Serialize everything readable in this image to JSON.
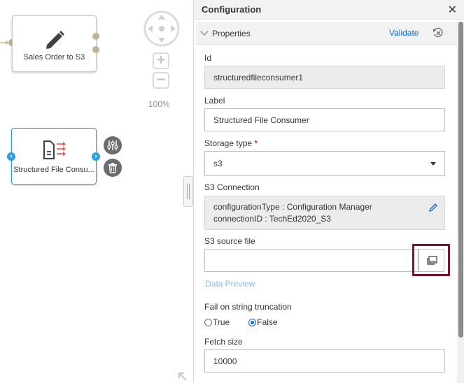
{
  "canvas": {
    "nodes": [
      {
        "label": "Sales Order to S3",
        "icon": "pencil-icon"
      },
      {
        "label": "Structured File Consu...",
        "icon": "structured-file-icon"
      }
    ],
    "node_actions": [
      "settings-sliders-icon",
      "trash-icon"
    ],
    "zoom_level": "100%",
    "nav_icon": "pan-navigation-icon"
  },
  "config": {
    "title": "Configuration",
    "close_icon": "close-icon",
    "section": {
      "title": "Properties",
      "validate": "Validate",
      "reset_icon": "reset-icon"
    },
    "fields": {
      "id": {
        "label": "Id",
        "value": "structuredfileconsumer1"
      },
      "label": {
        "label": "Label",
        "value": "Structured File Consumer"
      },
      "storage_type": {
        "label": "Storage type",
        "required_mark": "*",
        "value": "s3"
      },
      "s3_connection": {
        "label": "S3 Connection",
        "line1": "configurationType : Configuration Manager",
        "line2": "connectionID : TechEd2020_S3"
      },
      "s3_source_file": {
        "label": "S3 source file",
        "value": ""
      },
      "data_preview": "Data Preview",
      "fail_on_truncation": {
        "label": "Fail on string truncation",
        "options": [
          "True",
          "False"
        ],
        "selected": "False"
      },
      "fetch_size": {
        "label": "Fetch size",
        "value": "10000"
      }
    }
  },
  "colors": {
    "accent": "#0a6ed1",
    "highlight_box": "#7b1430",
    "port_blue": "#2f9de0"
  }
}
